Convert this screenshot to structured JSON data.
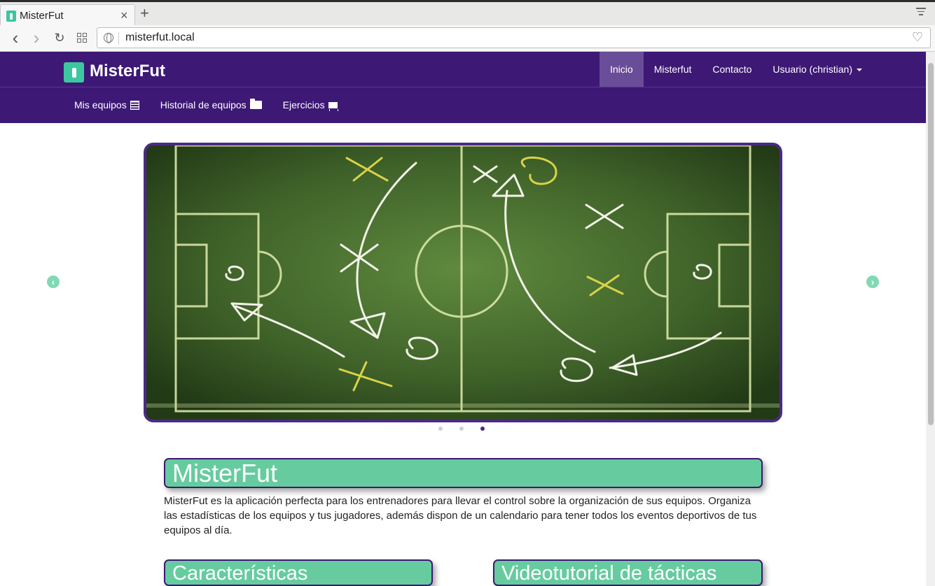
{
  "browser": {
    "tab_title": "MisterFut",
    "close_glyph": "×",
    "new_tab_glyph": "+",
    "url": "misterfut.local",
    "back_glyph": "‹",
    "forward_glyph": "›",
    "reload_glyph": "↻",
    "heart_glyph": "♡"
  },
  "site": {
    "brand": "MisterFut",
    "top_nav": [
      {
        "label": "Inicio",
        "active": true
      },
      {
        "label": "Misterfut",
        "active": false
      },
      {
        "label": "Contacto",
        "active": false
      },
      {
        "label": "Usuario (christian)",
        "active": false,
        "dropdown": true
      }
    ],
    "sub_nav": [
      {
        "label": "Mis equipos",
        "icon": "list-icon"
      },
      {
        "label": "Historial de equipos",
        "icon": "folder-open-icon"
      },
      {
        "label": "Ejercicios",
        "icon": "blackboard-icon"
      }
    ],
    "colors": {
      "brand_purple": "#3d1875",
      "accent_green": "#66cc9f",
      "active_nav": "#6a4d98"
    }
  },
  "carousel": {
    "prev_glyph": "‹",
    "next_glyph": "›",
    "slide_count": 3,
    "active_index": 2,
    "image": "football-tactics-chalkboard"
  },
  "content": {
    "main_title": "MisterFut",
    "intro": "MisterFut es la aplicación perfecta para los entrenadores para llevar el control sobre la organización de sus equipos. Organiza las estadísticas de los equipos y tus jugadores, además dispon de un calendario para tener todos los eventos deportivos de tus equipos al día.",
    "features_title": "Características",
    "video_title": "Videotutorial de tácticas"
  }
}
